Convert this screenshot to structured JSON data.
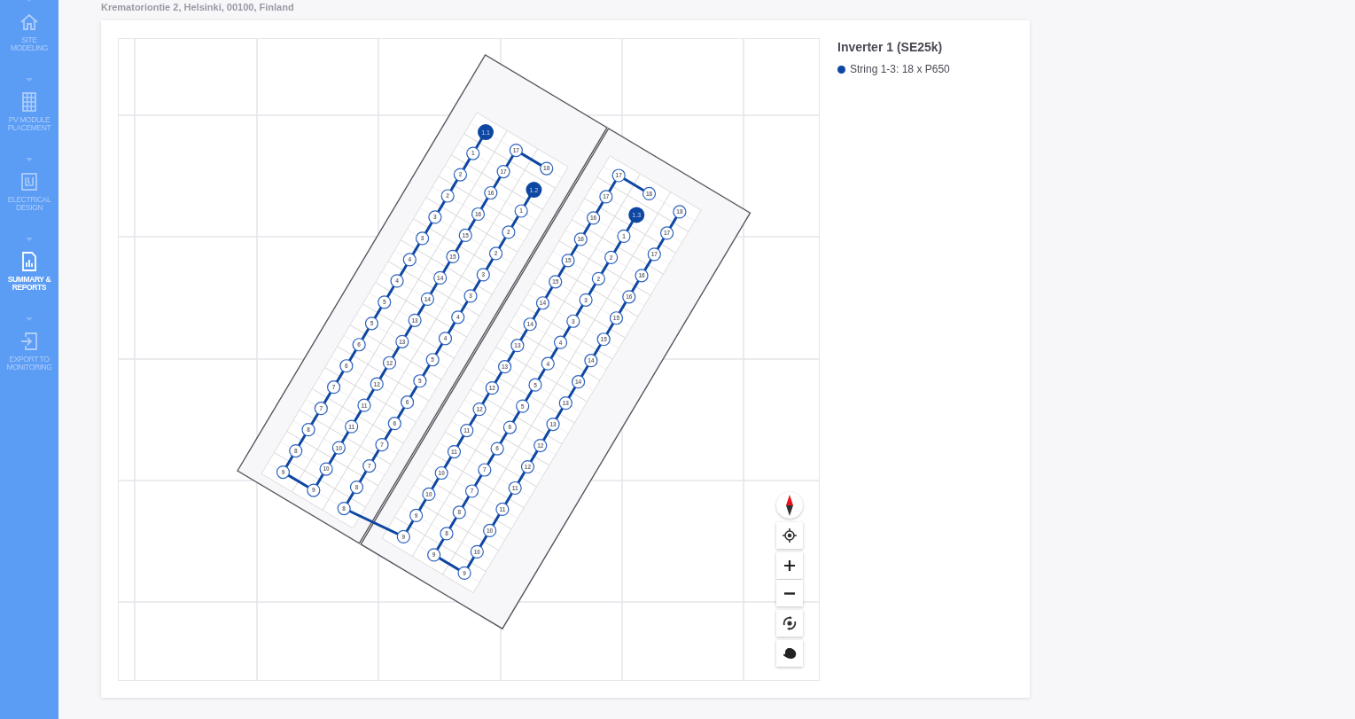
{
  "address": "Krematoriontie 2, Helsinki, 00100, Finland",
  "sidebar": {
    "items": [
      {
        "label": "SITE MODELING",
        "selected": false
      },
      {
        "label": "PV MODULE PLACEMENT",
        "selected": false
      },
      {
        "label": "ELECTRICAL DESIGN",
        "selected": false
      },
      {
        "label": "SUMMARY & REPORTS",
        "selected": true
      },
      {
        "label": "EXPORT TO MONITORING",
        "selected": false
      }
    ]
  },
  "map": {
    "strings": [
      {
        "marker": "1.1",
        "runs": [
          [
            "1",
            "2",
            "2",
            "3",
            "3",
            "4",
            "4",
            "5",
            "5",
            "6",
            "6",
            "7",
            "7",
            "8",
            "8",
            "9"
          ],
          [
            "9",
            "10",
            "10",
            "11",
            "11",
            "12",
            "12",
            "13",
            "13",
            "14",
            "14",
            "15",
            "15",
            "16",
            "16",
            "17",
            "17"
          ],
          [
            "18"
          ]
        ]
      },
      {
        "marker": "1.2",
        "runs": [
          [
            "1",
            "2",
            "2",
            "3",
            "3",
            "4",
            "4",
            "5",
            "5",
            "6",
            "6",
            "7",
            "7",
            "8",
            "8"
          ],
          [
            "9",
            "9",
            "10",
            "10",
            "11",
            "11",
            "12",
            "12",
            "13",
            "13",
            "14",
            "14",
            "15",
            "15",
            "16",
            "16",
            "17",
            "17"
          ],
          [
            "18"
          ]
        ]
      },
      {
        "marker": "1.3",
        "runs": [
          [
            "1",
            "2",
            "2",
            "3",
            "3",
            "4",
            "4",
            "5",
            "5",
            "6",
            "6",
            "7",
            "7",
            "8",
            "8",
            "9"
          ],
          [
            "9",
            "10",
            "10",
            "11",
            "11",
            "12",
            "12",
            "13",
            "13",
            "14",
            "14",
            "15",
            "15",
            "16",
            "16",
            "17",
            "17",
            "18"
          ]
        ]
      }
    ]
  },
  "inverter": {
    "title": "Inverter 1 (SE25k)",
    "legend": [
      {
        "label": "String 1-3: 18 x P650",
        "color": "#0d47a1"
      }
    ]
  }
}
